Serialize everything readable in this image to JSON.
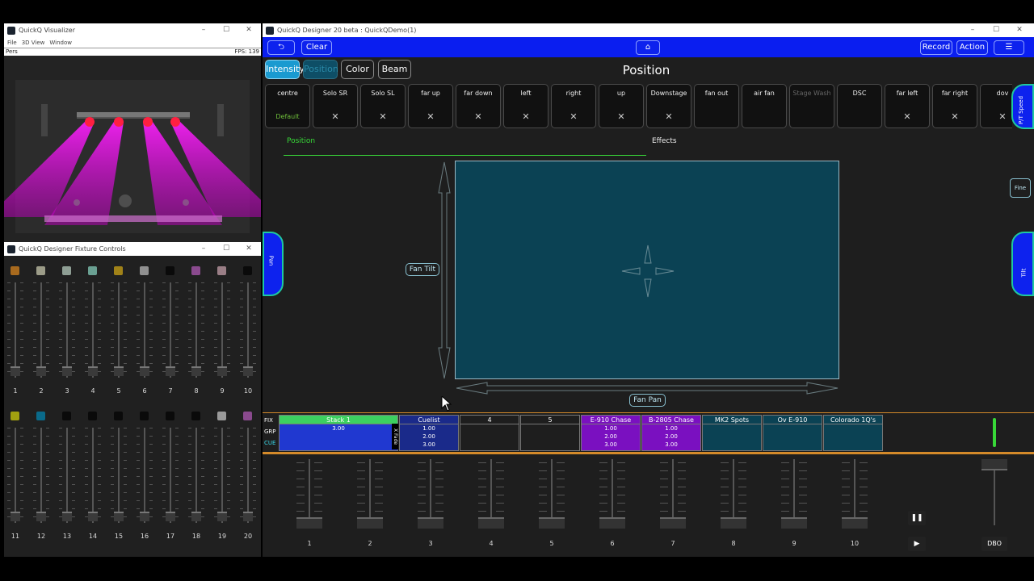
{
  "visualizer": {
    "title": "QuickQ Visualizer",
    "menu": [
      "File",
      "3D View",
      "Window"
    ],
    "mode": "Pers",
    "fps": "FPS: 139"
  },
  "fixture_controls": {
    "title": "QuickQ Designer Fixture Controls",
    "row1": {
      "colors": [
        "#a86a1e",
        "#9c9c88",
        "#8e9e94",
        "#6aa092",
        "#a08218",
        "#909090",
        "#0a0a0a",
        "#8a4a8e",
        "#9a7e86",
        "#0a0a0a"
      ],
      "numbers": [
        "1",
        "2",
        "3",
        "4",
        "5",
        "6",
        "7",
        "8",
        "9",
        "10"
      ]
    },
    "row2": {
      "colors": [
        "#a2a010",
        "#0a6a8a",
        "#0a0a0a",
        "#0a0a0a",
        "#0a0a0a",
        "#0a0a0a",
        "#0a0a0a",
        "#0a0a0a",
        "#9a9a9a",
        "#8a4a8e"
      ],
      "numbers": [
        "11",
        "12",
        "13",
        "14",
        "15",
        "16",
        "17",
        "18",
        "19",
        "20"
      ]
    }
  },
  "main": {
    "title": "QuickQ Designer 20 beta : QuickQDemo(1)",
    "toolbar": {
      "clear": "Clear",
      "record": "Record",
      "action": "Action"
    },
    "tabs": [
      "Intensity",
      "Position",
      "Color",
      "Beam"
    ],
    "page_title": "Position",
    "presets": [
      {
        "name": "centre",
        "sub": "Default"
      },
      {
        "name": "Solo SR",
        "sub": "✕"
      },
      {
        "name": "Solo SL",
        "sub": "✕"
      },
      {
        "name": "far up",
        "sub": "✕"
      },
      {
        "name": "far down",
        "sub": "✕"
      },
      {
        "name": "left",
        "sub": "✕"
      },
      {
        "name": "right",
        "sub": "✕"
      },
      {
        "name": "up",
        "sub": "✕"
      },
      {
        "name": "Downstage",
        "sub": "✕"
      },
      {
        "name": "fan out",
        "sub": ""
      },
      {
        "name": "air fan",
        "sub": ""
      },
      {
        "name": "Stage Wash",
        "sub": ""
      },
      {
        "name": "DSC",
        "sub": ""
      },
      {
        "name": "far left",
        "sub": "✕"
      },
      {
        "name": "far right",
        "sub": "✕"
      },
      {
        "name": "dov",
        "sub": "✕"
      }
    ],
    "subtabs": {
      "position": "Position",
      "effects": "Effects"
    },
    "side": {
      "pt_speed": "P/T Speed",
      "pan": "Pan",
      "tilt": "Tilt",
      "fine": "Fine"
    },
    "fan_tilt": "Fan Tilt",
    "fan_pan": "Fan Pan",
    "row_labels": [
      "FIX",
      "GRP",
      "CUE"
    ],
    "cuelists": [
      {
        "name": "Stack 1",
        "vals": [
          "3.00"
        ]
      },
      {
        "name": "Cuelist",
        "vals": [
          "1.00",
          "2.00",
          "3.00"
        ]
      },
      {
        "name": "4",
        "vals": []
      },
      {
        "name": "5",
        "vals": []
      },
      {
        "name": "E-910 Chase",
        "vals": [
          "1.00",
          "2.00",
          "3.00"
        ]
      },
      {
        "name": "B-2805 Chase",
        "vals": [
          "1.00",
          "2.00",
          "3.00"
        ]
      },
      {
        "name": "MK2 Spots",
        "vals": []
      },
      {
        "name": "Ov E-910",
        "vals": []
      },
      {
        "name": "Colorado 1Q's",
        "vals": []
      }
    ],
    "xfade": "X Fade",
    "fader_numbers": [
      "1",
      "2",
      "3",
      "4",
      "5",
      "6",
      "7",
      "8",
      "9",
      "10"
    ],
    "dbo": "DBO"
  }
}
